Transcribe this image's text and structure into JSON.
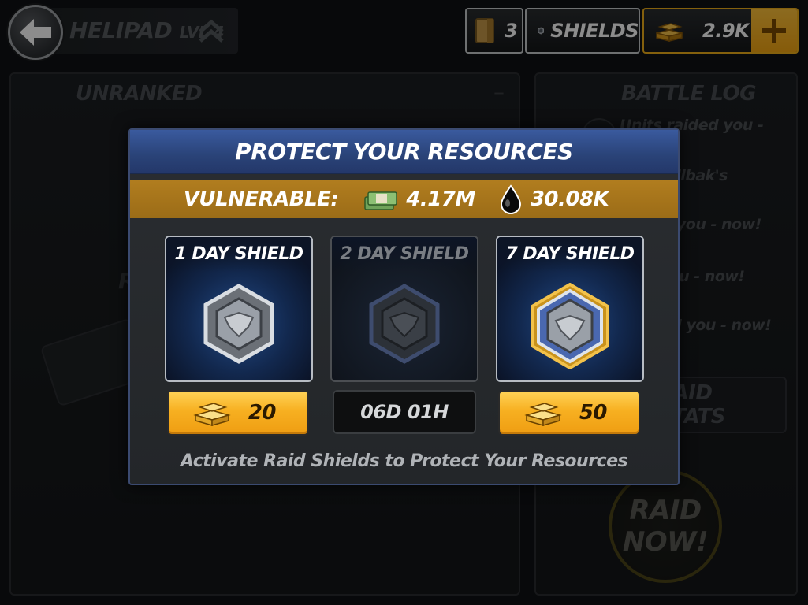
{
  "topbar": {
    "title": "HELIPAD",
    "level": "LVL 4",
    "intel_count": "3",
    "shields_label": "SHIELDS",
    "gold_amount": "2.9K"
  },
  "background": {
    "left_panel_title": "UNRANKED",
    "left_panel_partial": "REV",
    "right_panel_title": "BATTLE LOG",
    "log_entries": [
      "Units raided you - now!",
      "LED Rollbak's",
      "raided you - now!",
      "ided you - now!",
      "/ raided you - now!"
    ],
    "raid_stats_label": "RAID STATS",
    "raid_now_label": "RAID NOW!"
  },
  "modal": {
    "title": "PROTECT YOUR RESOURCES",
    "vulnerable_label": "VULNERABLE:",
    "cash_value": "4.17M",
    "oil_value": "30.08K",
    "shields": [
      {
        "label": "1 DAY SHIELD",
        "price": "20",
        "state": "available"
      },
      {
        "label": "2 DAY SHIELD",
        "cooldown": "06D 01H",
        "state": "cooldown"
      },
      {
        "label": "7 DAY SHIELD",
        "price": "50",
        "state": "available"
      }
    ],
    "footer": "Activate Raid Shields to Protect Your Resources"
  },
  "colors": {
    "header_blue": "#2a4378",
    "vulnerable_bar": "#9b6c17",
    "gold_button": "#f7b021",
    "gold_accent": "#f0b019"
  },
  "icons": {
    "back": "arrow-left-icon",
    "intel": "folder-icon",
    "shield": "shield-hex-icon",
    "gold": "gold-bars-icon",
    "plus": "plus-icon",
    "cash": "cash-stack-icon",
    "oil": "oil-drop-icon"
  }
}
